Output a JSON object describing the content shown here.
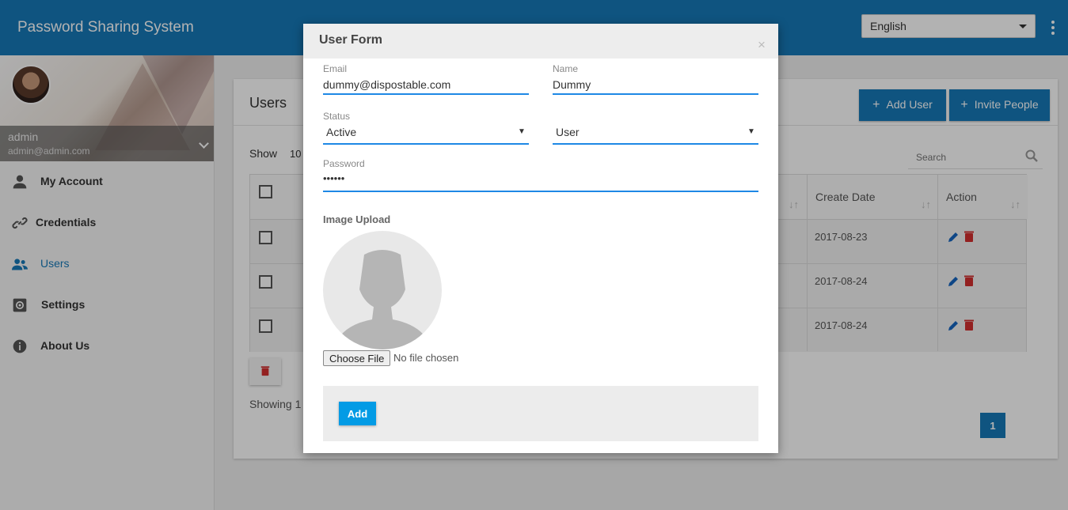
{
  "header": {
    "app_title": "Password Sharing System",
    "language": "English"
  },
  "sidebar": {
    "user_name": "admin",
    "user_email": "admin@admin.com",
    "items": [
      {
        "label": "My Account",
        "icon": "person-icon"
      },
      {
        "label": "Credentials",
        "icon": "link-icon"
      },
      {
        "label": "Users",
        "icon": "users-icon",
        "active": true
      },
      {
        "label": "Settings",
        "icon": "gear-icon"
      },
      {
        "label": "About Us",
        "icon": "info-icon"
      }
    ]
  },
  "main": {
    "title": "Users",
    "add_user_label": "Add User",
    "invite_people_label": "Invite People",
    "show_label": "Show",
    "show_value": "10",
    "search_placeholder": "Search",
    "columns": [
      "Create Date",
      "Action"
    ],
    "rows": [
      {
        "create_date": "2017-08-23"
      },
      {
        "create_date": "2017-08-24"
      },
      {
        "create_date": "2017-08-24"
      }
    ],
    "showing_text": "Showing 1",
    "current_page": "1"
  },
  "modal": {
    "title": "User Form",
    "close_symbol": "×",
    "email_label": "Email",
    "email_value": "dummy@dispostable.com",
    "name_label": "Name",
    "name_value": "Dummy",
    "status_label": "Status",
    "status_value": "Active",
    "role_value": "User",
    "password_label": "Password",
    "password_value": "••••••",
    "image_upload_label": "Image Upload",
    "choose_file_label": "Choose File",
    "no_file_text": "No file chosen",
    "add_label": "Add"
  },
  "colors": {
    "primary": "#1679b8",
    "input_underline": "#1e88e5",
    "add_button": "#039be5",
    "delete_icon": "#d32f2f"
  }
}
